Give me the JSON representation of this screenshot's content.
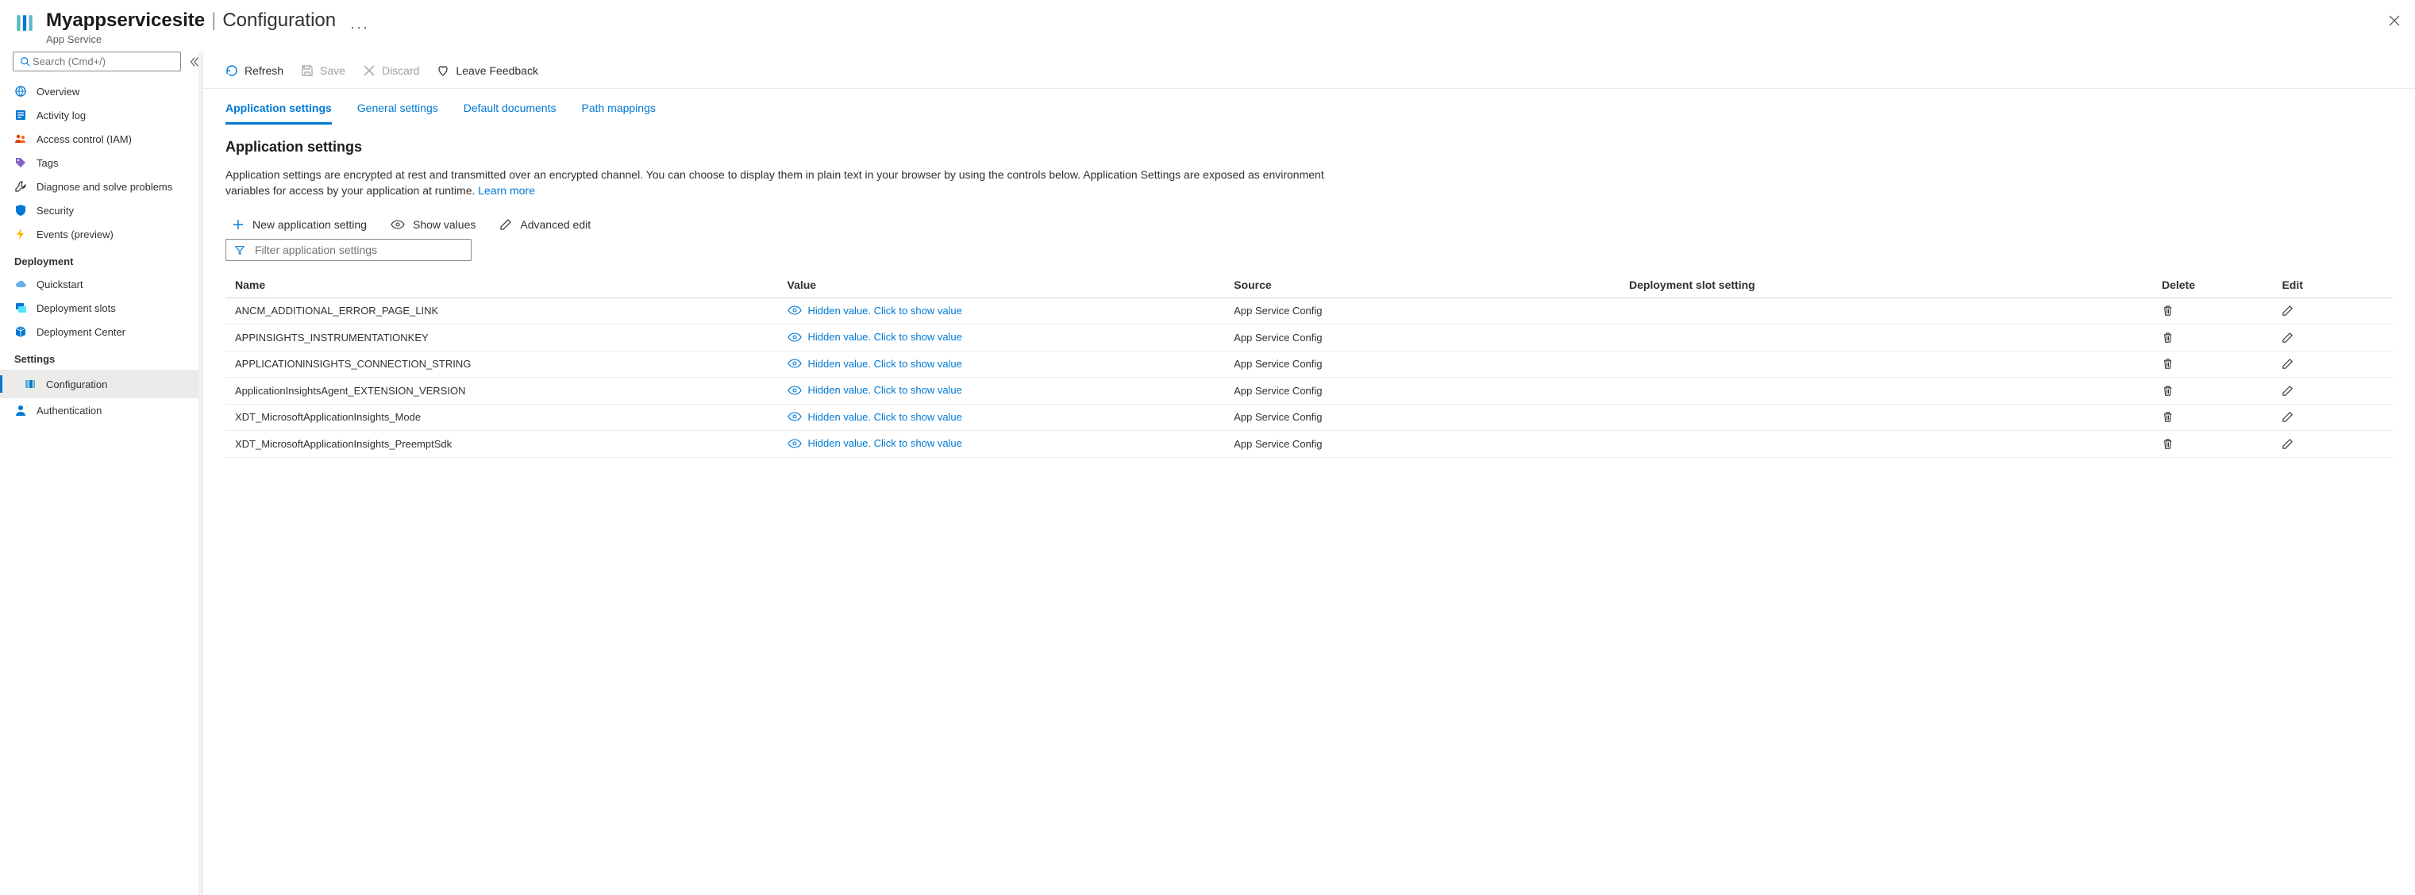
{
  "header": {
    "title_main": "Myappservicesite",
    "title_section": "Configuration",
    "subtitle": "App Service",
    "more_glyph": "···"
  },
  "sidebar": {
    "search_placeholder": "Search (Cmd+/)",
    "items_top": [
      {
        "label": "Overview",
        "name": "nav-overview",
        "icon": "globe"
      },
      {
        "label": "Activity log",
        "name": "nav-activity",
        "icon": "log"
      },
      {
        "label": "Access control (IAM)",
        "name": "nav-iam",
        "icon": "people"
      },
      {
        "label": "Tags",
        "name": "nav-tags",
        "icon": "tag"
      },
      {
        "label": "Diagnose and solve problems",
        "name": "nav-diagnose",
        "icon": "wrench"
      },
      {
        "label": "Security",
        "name": "nav-security",
        "icon": "shield"
      },
      {
        "label": "Events (preview)",
        "name": "nav-events",
        "icon": "bolt"
      }
    ],
    "section_deployment": "Deployment",
    "items_deployment": [
      {
        "label": "Quickstart",
        "name": "nav-quickstart",
        "icon": "cloud"
      },
      {
        "label": "Deployment slots",
        "name": "nav-deploy-slots",
        "icon": "slots"
      },
      {
        "label": "Deployment Center",
        "name": "nav-deploy-center",
        "icon": "cube"
      }
    ],
    "section_settings": "Settings",
    "items_settings": [
      {
        "label": "Configuration",
        "name": "nav-configuration",
        "icon": "bars",
        "selected": true
      },
      {
        "label": "Authentication",
        "name": "nav-authentication",
        "icon": "person"
      }
    ]
  },
  "toolbar": {
    "refresh": "Refresh",
    "save": "Save",
    "discard": "Discard",
    "feedback": "Leave Feedback"
  },
  "tabs": [
    {
      "label": "Application settings",
      "key": "app",
      "active": true
    },
    {
      "label": "General settings",
      "key": "gen",
      "active": false
    },
    {
      "label": "Default documents",
      "key": "docs",
      "active": false
    },
    {
      "label": "Path mappings",
      "key": "path",
      "active": false
    }
  ],
  "section": {
    "title": "Application settings",
    "description": "Application settings are encrypted at rest and transmitted over an encrypted channel. You can choose to display them in plain text in your browser by using the controls below. Application Settings are exposed as environment variables for access by your application at runtime. ",
    "learn_more": "Learn more"
  },
  "actions": {
    "new_setting": "New application setting",
    "show_values": "Show values",
    "advanced_edit": "Advanced edit",
    "filter_placeholder": "Filter application settings"
  },
  "table": {
    "columns": {
      "name": "Name",
      "value": "Value",
      "source": "Source",
      "slot": "Deployment slot setting",
      "delete": "Delete",
      "edit": "Edit"
    },
    "hidden_value_text": "Hidden value. Click to show value",
    "rows": [
      {
        "name": "ANCM_ADDITIONAL_ERROR_PAGE_LINK",
        "source": "App Service Config"
      },
      {
        "name": "APPINSIGHTS_INSTRUMENTATIONKEY",
        "source": "App Service Config"
      },
      {
        "name": "APPLICATIONINSIGHTS_CONNECTION_STRING",
        "source": "App Service Config"
      },
      {
        "name": "ApplicationInsightsAgent_EXTENSION_VERSION",
        "source": "App Service Config"
      },
      {
        "name": "XDT_MicrosoftApplicationInsights_Mode",
        "source": "App Service Config"
      },
      {
        "name": "XDT_MicrosoftApplicationInsights_PreemptSdk",
        "source": "App Service Config"
      }
    ]
  },
  "colors": {
    "accent": "#0078d4",
    "azure_web_teal": "#5db7c6"
  }
}
